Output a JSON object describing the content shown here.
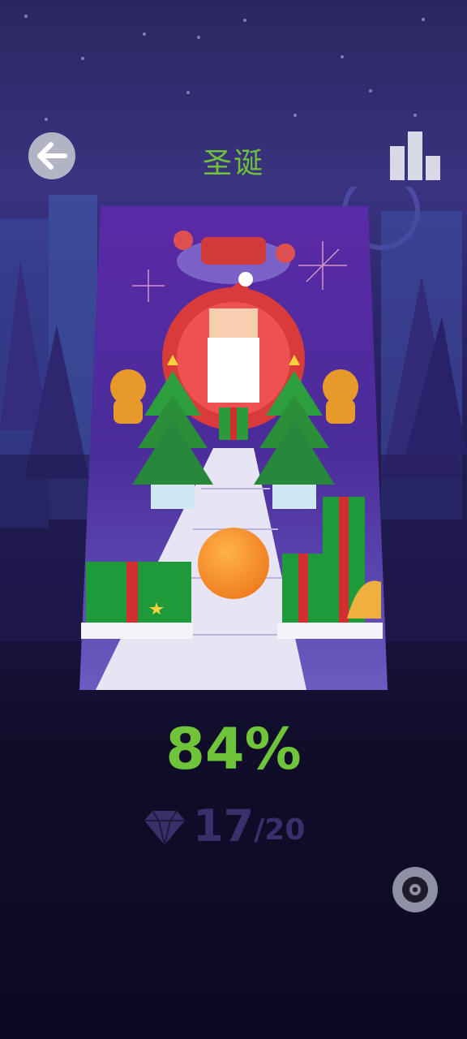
{
  "header": {
    "title": "圣诞",
    "back_icon": "arrow-left-icon",
    "leaderboard_icon": "bar-chart-icon"
  },
  "level_card": {
    "theme": "christmas"
  },
  "progress": {
    "percent_label": "84%",
    "percent_value": 84
  },
  "gems": {
    "icon": "diamond-icon",
    "collected": "17",
    "total": "/20"
  },
  "footer": {
    "disc_icon": "music-disc-icon"
  },
  "colors": {
    "accent_green": "#6fc43a",
    "gem_purple": "#3a2f6a",
    "ball_orange": "#f5902a"
  }
}
